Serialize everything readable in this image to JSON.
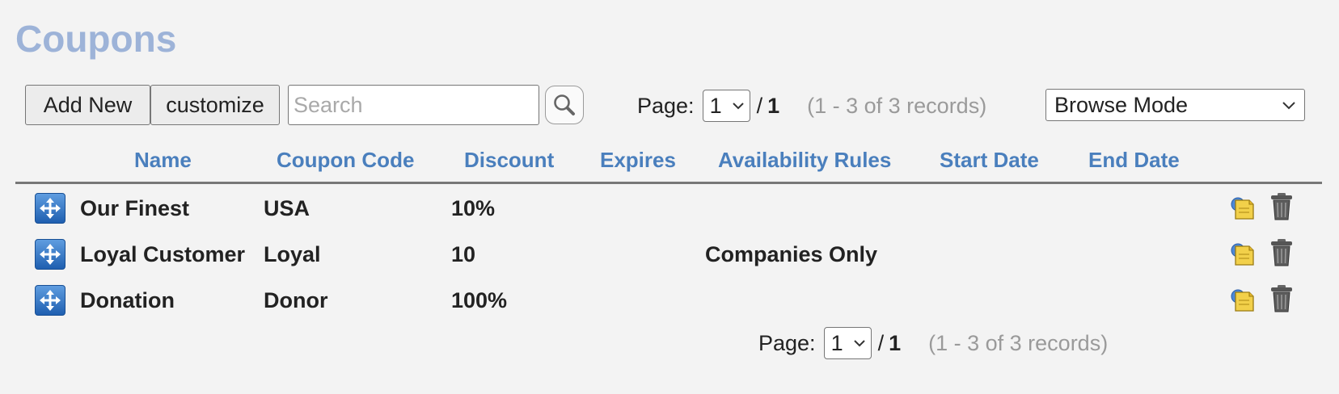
{
  "page": {
    "title": "Coupons"
  },
  "toolbar": {
    "add_new_label": "Add New",
    "customize_label": "customize",
    "search_placeholder": "Search",
    "search_value": "",
    "mode_selected": "Browse Mode"
  },
  "pager": {
    "label": "Page:",
    "current": "1",
    "separator": "/",
    "total": "1",
    "records": "(1 - 3 of 3 records)"
  },
  "table": {
    "columns": [
      "Name",
      "Coupon Code",
      "Discount",
      "Expires",
      "Availability Rules",
      "Start Date",
      "End Date"
    ],
    "rows": [
      {
        "name": "Our Finest",
        "code": "USA",
        "discount": "10%",
        "expires": "",
        "availability": "",
        "start": "",
        "end": ""
      },
      {
        "name": "Loyal Customer",
        "code": "Loyal",
        "discount": "10",
        "expires": "",
        "availability": "Companies Only",
        "start": "",
        "end": ""
      },
      {
        "name": "Donation",
        "code": "Donor",
        "discount": "100%",
        "expires": "",
        "availability": "",
        "start": "",
        "end": ""
      }
    ]
  },
  "icons": {
    "search": "magnifier-icon",
    "drag": "move-arrows-icon",
    "edit": "edit-record-icon",
    "delete": "trash-icon",
    "dropdown": "chevron-down-icon"
  },
  "colors": {
    "title": "#9db3d8",
    "column_header": "#4a7fbd",
    "muted": "#9a9a9a",
    "background": "#f3f3f3"
  }
}
